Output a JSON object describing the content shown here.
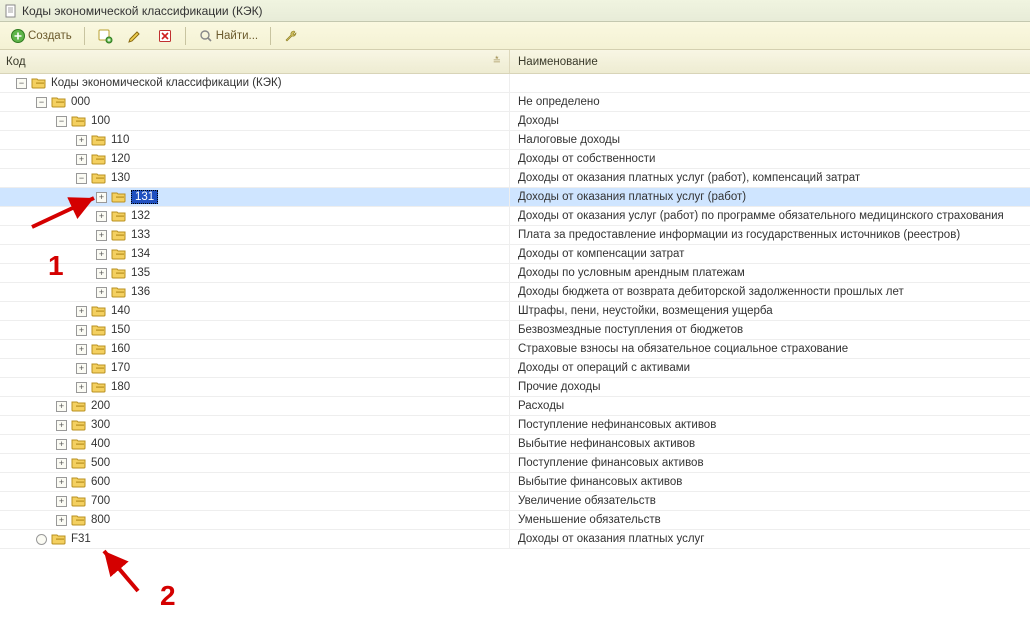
{
  "title": "Коды экономической классификации (КЭК)",
  "toolbar": {
    "create": "Создать",
    "find": "Найти..."
  },
  "columns": {
    "code": "Код",
    "name": "Наименование"
  },
  "tree": [
    {
      "indent": 0,
      "exp": "-",
      "code": "Коды экономической классификации (КЭК)",
      "name": "",
      "iconType": "folder"
    },
    {
      "indent": 1,
      "exp": "-",
      "code": "000",
      "name": "Не определено"
    },
    {
      "indent": 2,
      "exp": "-",
      "code": "100",
      "name": "Доходы"
    },
    {
      "indent": 3,
      "exp": "+",
      "code": "110",
      "name": "Налоговые доходы"
    },
    {
      "indent": 3,
      "exp": "+",
      "code": "120",
      "name": "Доходы от собственности"
    },
    {
      "indent": 3,
      "exp": "-",
      "code": "130",
      "name": "Доходы от оказания платных услуг (работ), компенсаций затрат"
    },
    {
      "indent": 4,
      "exp": "+",
      "code": "131",
      "name": "Доходы от оказания платных услуг (работ)",
      "selected": true
    },
    {
      "indent": 4,
      "exp": "+",
      "code": "132",
      "name": "Доходы от оказания услуг (работ) по программе обязательного медицинского страхования"
    },
    {
      "indent": 4,
      "exp": "+",
      "code": "133",
      "name": "Плата за предоставление информации из государственных источников (реестров)"
    },
    {
      "indent": 4,
      "exp": "+",
      "code": "134",
      "name": "Доходы от компенсации затрат"
    },
    {
      "indent": 4,
      "exp": "+",
      "code": "135",
      "name": "Доходы по условным арендным платежам"
    },
    {
      "indent": 4,
      "exp": "+",
      "code": "136",
      "name": "Доходы бюджета от возврата дебиторской задолженности прошлых лет"
    },
    {
      "indent": 3,
      "exp": "+",
      "code": "140",
      "name": "Штрафы, пени, неустойки, возмещения ущерба"
    },
    {
      "indent": 3,
      "exp": "+",
      "code": "150",
      "name": "Безвозмездные поступления от бюджетов"
    },
    {
      "indent": 3,
      "exp": "+",
      "code": "160",
      "name": "Страховые взносы на обязательное социальное страхование"
    },
    {
      "indent": 3,
      "exp": "+",
      "code": "170",
      "name": "Доходы от операций с активами"
    },
    {
      "indent": 3,
      "exp": "+",
      "code": "180",
      "name": "Прочие доходы"
    },
    {
      "indent": 2,
      "exp": "+",
      "code": "200",
      "name": "Расходы"
    },
    {
      "indent": 2,
      "exp": "+",
      "code": "300",
      "name": "Поступление нефинансовых активов"
    },
    {
      "indent": 2,
      "exp": "+",
      "code": "400",
      "name": "Выбытие нефинансовых активов"
    },
    {
      "indent": 2,
      "exp": "+",
      "code": "500",
      "name": "Поступление финансовых активов"
    },
    {
      "indent": 2,
      "exp": "+",
      "code": "600",
      "name": "Выбытие финансовых активов"
    },
    {
      "indent": 2,
      "exp": "+",
      "code": "700",
      "name": "Увеличение обязательств"
    },
    {
      "indent": 2,
      "exp": "+",
      "code": "800",
      "name": "Уменьшение обязательств"
    },
    {
      "indent": 1,
      "exp": "o",
      "code": "F31",
      "name": "Доходы от оказания платных услуг"
    }
  ],
  "annotations": {
    "num1": "1",
    "num2": "2"
  }
}
